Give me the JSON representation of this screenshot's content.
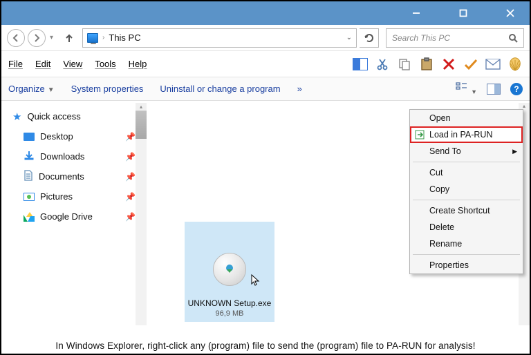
{
  "titlebar": {
    "minimize": "minimize",
    "maximize": "maximize",
    "close": "close"
  },
  "address": {
    "location": "This PC"
  },
  "search": {
    "placeholder": "Search This PC"
  },
  "menus": {
    "file": "File",
    "edit": "Edit",
    "view": "View",
    "tools": "Tools",
    "help": "Help"
  },
  "commands": {
    "organize": "Organize",
    "system_props": "System properties",
    "uninstall": "Uninstall or change a program",
    "more": "»"
  },
  "sidebar": {
    "items": [
      {
        "label": "Quick access"
      },
      {
        "label": "Desktop"
      },
      {
        "label": "Downloads"
      },
      {
        "label": "Documents"
      },
      {
        "label": "Pictures"
      },
      {
        "label": "Google Drive"
      }
    ]
  },
  "file": {
    "name": "UNKNOWN Setup.exe",
    "size": "96,9 MB"
  },
  "context_menu": {
    "open": "Open",
    "load": "Load in PA-RUN",
    "sendto": "Send To",
    "cut": "Cut",
    "copy": "Copy",
    "shortcut": "Create Shortcut",
    "del": "Delete",
    "rename": "Rename",
    "props": "Properties"
  },
  "caption": "In Windows Explorer, right-click any (program) file to send the (program) file to PA-RUN for analysis!"
}
